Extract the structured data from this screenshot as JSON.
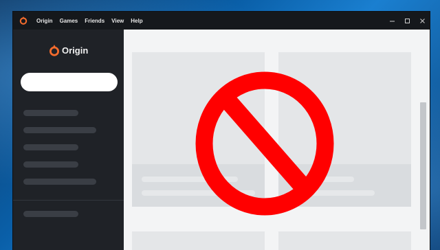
{
  "window": {
    "menu": [
      "Origin",
      "Games",
      "Friends",
      "View",
      "Help"
    ],
    "controls": {
      "minimize": "minimize-icon",
      "maximize": "maximize-icon",
      "close": "close-icon"
    }
  },
  "sidebar": {
    "brand_name": "Origin",
    "search_placeholder": ""
  },
  "overlay": {
    "icon": "prohibition-icon",
    "color": "#ff0000"
  },
  "colors": {
    "accent": "#f56c2d",
    "titlebar": "#15181c",
    "sidebar": "#1f2227",
    "main": "#f3f4f5"
  }
}
